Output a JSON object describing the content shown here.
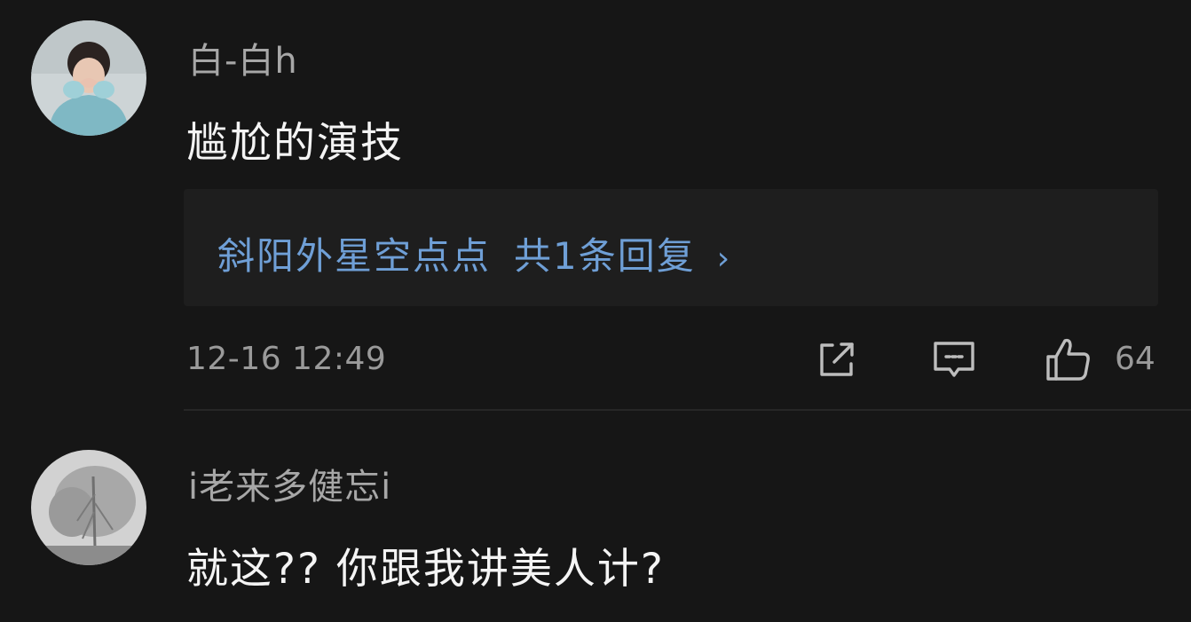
{
  "comments": [
    {
      "username": "白-白h",
      "content": "尴尬的演技",
      "reply_preview": {
        "author": "斜阳外星空点点",
        "summary": "共1条回复",
        "chevron": "›"
      },
      "timestamp": "12-16 12:49",
      "like_count": "64"
    },
    {
      "username": "i老来多健忘i",
      "content": "就这?? 你跟我讲美人计?"
    }
  ],
  "icons": {
    "share": "share-icon",
    "reply": "comment-icon",
    "like": "thumbs-up-icon",
    "chevron": "chevron-right-icon"
  },
  "colors": {
    "background": "#161616",
    "reply_box": "#1e1e1e",
    "link": "#6f9fd6",
    "username": "#a7a7a7",
    "meta": "#9a9a9a"
  }
}
